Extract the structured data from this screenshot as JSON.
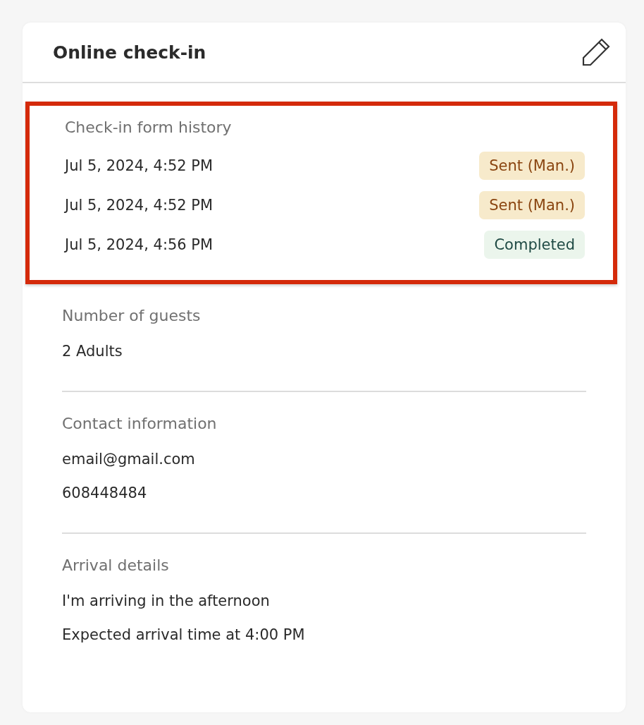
{
  "card": {
    "title": "Online check-in"
  },
  "history": {
    "label": "Check-in form history",
    "highlighted": true,
    "entries": [
      {
        "date": "Jul 5, 2024, 4:52 PM",
        "status": {
          "kind": "sent",
          "label": "Sent (Man.)"
        }
      },
      {
        "date": "Jul 5, 2024, 4:52 PM",
        "status": {
          "kind": "sent",
          "label": "Sent (Man.)"
        }
      },
      {
        "date": "Jul 5, 2024, 4:56 PM",
        "status": {
          "kind": "completed",
          "label": "Completed"
        }
      }
    ]
  },
  "sections": [
    {
      "label": "Number of guests",
      "lines": [
        "2 Adults"
      ]
    },
    {
      "label": "Contact information",
      "lines": [
        "email@gmail.com",
        "608448484"
      ]
    },
    {
      "label": "Arrival details",
      "lines": [
        "I'm arriving in the afternoon",
        "Expected arrival time at 4:00 PM"
      ]
    }
  ]
}
